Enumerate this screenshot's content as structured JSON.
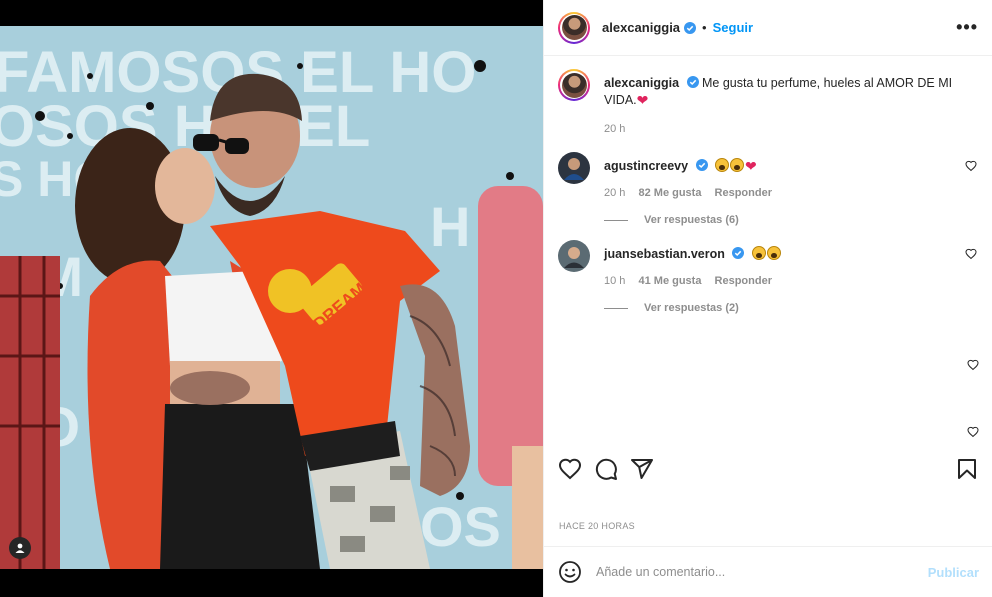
{
  "post": {
    "username": "alexcaniggia",
    "follow_label": "Seguir",
    "dot": "•",
    "more_label": "•••"
  },
  "comments": [
    {
      "username": "alexcaniggia",
      "text": "Me gusta tu perfume, hueles al AMOR DE MI VIDA.",
      "emoji": "❤",
      "time": "20 h"
    },
    {
      "username": "agustincreevy",
      "time": "20 h",
      "likes": "82 Me gusta",
      "reply_label": "Responder",
      "view_replies": "Ver respuestas (6)",
      "emoji_trailing": "❤"
    },
    {
      "username": "juansebastian.veron",
      "time": "10 h",
      "likes": "41 Me gusta",
      "reply_label": "Responder",
      "view_replies": "Ver respuestas (2)"
    }
  ],
  "footer": {
    "timestamp": "HACE 20 HORAS",
    "comment_placeholder": "Añade un comentario...",
    "publish_label": "Publicar"
  },
  "photo": {
    "background_text": "FAMOSOS EL HOTEL",
    "shirt_text": "DREAM"
  },
  "colors": {
    "link_blue": "#0095f6",
    "publish_disabled": "#b2dffc",
    "heart_red": "#e0245e"
  }
}
